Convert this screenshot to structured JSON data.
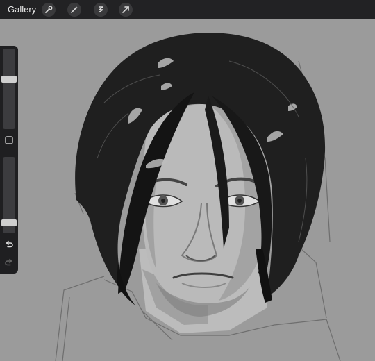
{
  "app": {
    "gallery_label": "Gallery"
  },
  "toolbar": {
    "tools": [
      "wrench-icon",
      "magic-wand-icon",
      "selection-icon",
      "transform-arrow-icon"
    ]
  },
  "sidebar": {
    "brush_size": 0.63,
    "opacity": 0.1
  },
  "colors": {
    "toolbar_bg": "#222224",
    "canvas_bg": "#9b9b9b",
    "sidebar_bg": "#1f1f21"
  }
}
